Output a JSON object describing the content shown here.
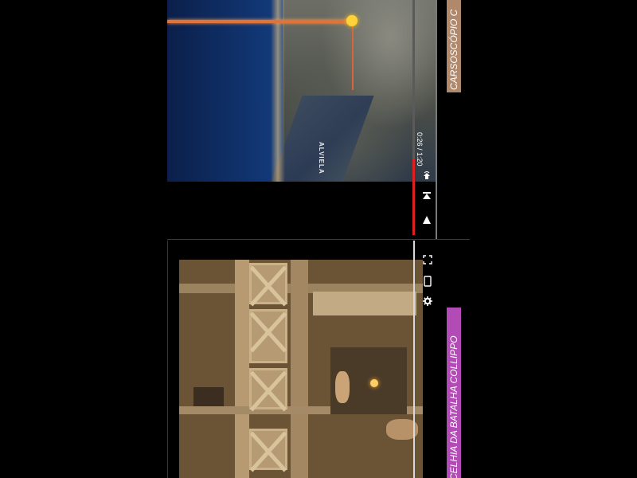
{
  "top_video": {
    "map_label": "ALVIELA",
    "time_display": "0:26 / 1:20",
    "progress_fraction": 0.325,
    "controls": {
      "play_icon": "play-icon",
      "next_icon": "skip-next-icon",
      "volume_icon": "volume-icon"
    },
    "title": "CARSOSCÓPIO C"
  },
  "bottom_video": {
    "title": "CELHIA DA BATALHA COLLIPPO",
    "controls": {
      "fullscreen_icon": "fullscreen-icon",
      "device_icon": "device-icon",
      "settings_icon": "gear-icon"
    }
  },
  "colors": {
    "progress_red": "#e02020",
    "title_top_bg": "#b0886c",
    "title_bottom_bg": "#b24bb5",
    "route_orange": "#e0733a"
  }
}
